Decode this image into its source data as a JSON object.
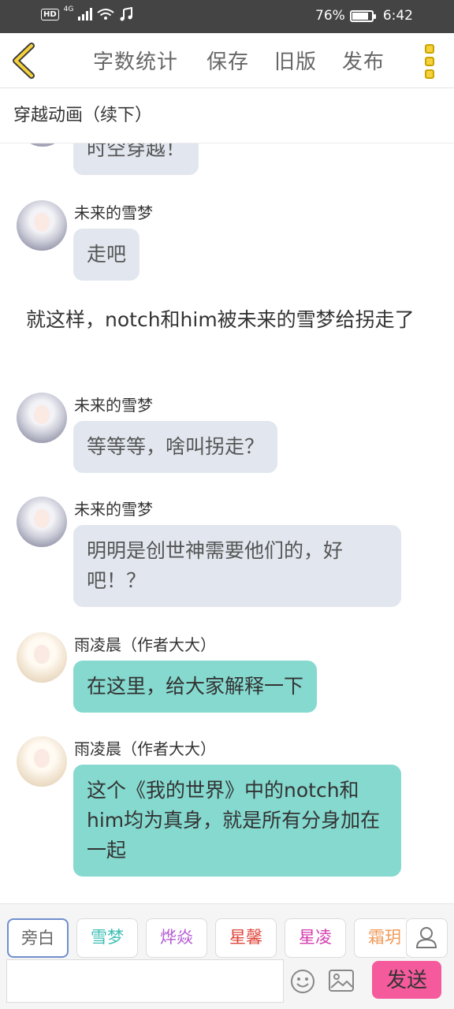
{
  "status_bar": {
    "hd": "HD",
    "network": "4G",
    "battery": "76%",
    "time": "6:42"
  },
  "toolbar": {
    "word_count": "字数统计",
    "save": "保存",
    "old_version": "旧版",
    "publish": "发布"
  },
  "document": {
    "title": "穿越动画（续下）"
  },
  "messages": [
    {
      "speaker": "",
      "text": "时空穿越！",
      "type": "bubble",
      "color": "#e2e7ef"
    },
    {
      "speaker": "未来的雪梦",
      "text": "走吧",
      "type": "bubble",
      "color": "#e2e7ef"
    },
    {
      "speaker": "",
      "text": "就这样，notch和him被未来的雪梦给拐走了",
      "type": "narration"
    },
    {
      "speaker": "未来的雪梦",
      "text": "等等等，啥叫拐走？",
      "type": "bubble",
      "color": "#e2e7ef"
    },
    {
      "speaker": "未来的雪梦",
      "text": "明明是创世神需要他们的，好吧！？",
      "type": "bubble",
      "color": "#e2e7ef"
    },
    {
      "speaker": "雨凌晨（作者大大）",
      "text": "在这里，给大家解释一下",
      "type": "bubble",
      "color": "#85d9cf"
    },
    {
      "speaker": "雨凌晨（作者大大）",
      "text": "这个《我的世界》中的notch和him均为真身，就是所有分身加在一起",
      "type": "bubble",
      "color": "#85d9cf"
    }
  ],
  "characters": [
    {
      "name": "旁白",
      "color": "#666666",
      "active": true
    },
    {
      "name": "雪梦",
      "color": "#3dbfb4",
      "active": false
    },
    {
      "name": "烨焱",
      "color": "#b45ad2",
      "active": false
    },
    {
      "name": "星馨",
      "color": "#e0453a",
      "active": false
    },
    {
      "name": "星凌",
      "color": "#d43dae",
      "active": false
    },
    {
      "name": "霜玥",
      "color": "#f09a5a",
      "active": false
    }
  ],
  "composer": {
    "input_value": "",
    "send": "发送"
  },
  "colors": {
    "status_bar": "#444444",
    "accent_yellow": "#f6d13b",
    "send_button": "#f55a9c",
    "bubble_gray": "#e2e7ef",
    "bubble_teal": "#85d9cf"
  },
  "icons": [
    "back-arrow-icon",
    "more-dots-icon",
    "emoji-icon",
    "image-icon",
    "user-icon",
    "wifi-icon",
    "signal-icon",
    "music-icon",
    "battery-icon"
  ]
}
